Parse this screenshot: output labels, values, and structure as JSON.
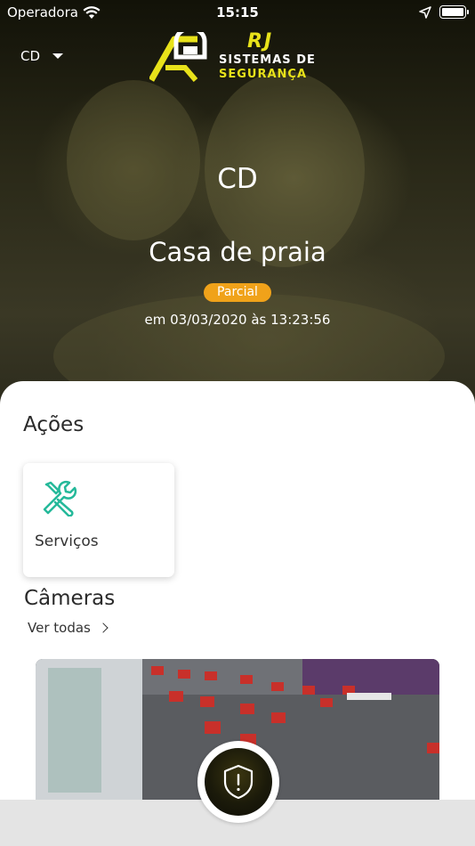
{
  "status_bar": {
    "carrier": "Operadora",
    "time": "15:15"
  },
  "header": {
    "account": "CD",
    "logo_rj": "RJ",
    "logo_line1": "SISTEMAS DE",
    "logo_line2": "SEGURANÇA"
  },
  "summary": {
    "initials": "CD",
    "place_name": "Casa de praia",
    "status": "Parcial",
    "status_time": "em 03/03/2020 às 13:23:56"
  },
  "actions": {
    "title": "Ações",
    "items": [
      {
        "label": "Serviços",
        "icon": "tools-icon"
      }
    ]
  },
  "cameras": {
    "title": "Câmeras",
    "see_all": "Ver todas"
  },
  "colors": {
    "accent_green": "#25b99a",
    "badge_orange": "#f0a21a",
    "logo_yellow": "#e8e21a"
  }
}
